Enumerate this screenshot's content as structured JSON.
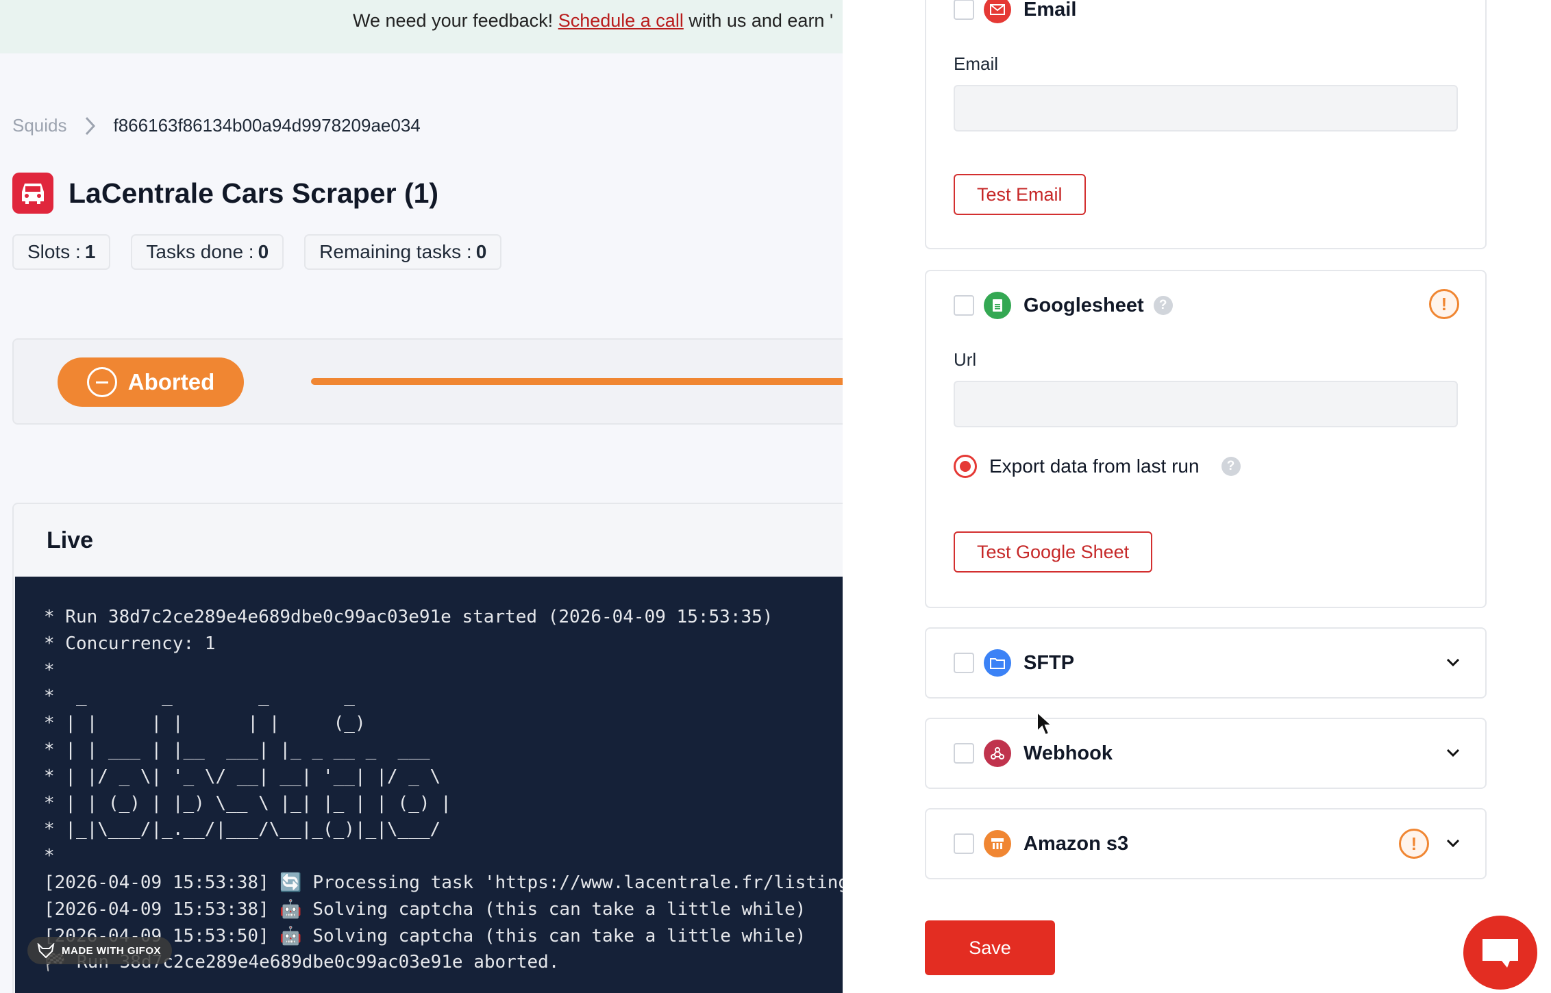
{
  "banner": {
    "text_before": "We need your feedback! ",
    "link": "Schedule a call",
    "text_after": " with us and earn '"
  },
  "breadcrumb": {
    "root": "Squids",
    "current": "f866163f86134b00a94d9978209ae034"
  },
  "header": {
    "title": "LaCentrale Cars Scraper (1)"
  },
  "stats": [
    {
      "label": "Slots : ",
      "value": "1"
    },
    {
      "label": "Tasks done : ",
      "value": "0"
    },
    {
      "label": "Remaining tasks : ",
      "value": "0"
    }
  ],
  "status": {
    "label": "Aborted",
    "progress_percent": 100,
    "color": "#f08632"
  },
  "live": {
    "title": "Live",
    "lines": [
      "* Run 38d7c2ce289e4e689dbe0c99ac03e91e started (2026-04-09 15:53:35)",
      "* Concurrency: 1",
      "*",
      "*  _       _        _       _",
      "* | |     | |      | |     (_)",
      "* | | ___ | |__  ___| |_ _ __ _  ___",
      "* | |/ _ \\| '_ \\/ __| __| '__| |/ _ \\",
      "* | | (_) | |_) \\__ \\ |_| |_ | | (_) |",
      "* |_|\\___/|_.__/|___/\\__|_(_)|_|\\___/",
      "*",
      "[2026-04-09 15:53:38] 🔄 Processing task 'https://www.lacentrale.fr/listing",
      "[2026-04-09 15:53:38] 🤖 Solving captcha (this can take a little while)",
      "[2026-04-09 15:53:50] 🤖 Solving captcha (this can take a little while)",
      "🏁 Run 38d7c2ce289e4e689dbe0c99ac03e91e aborted."
    ]
  },
  "watermark": "MADE WITH GIFOX",
  "integrations": {
    "email": {
      "name": "Email",
      "field_label": "Email",
      "value": "",
      "test_button": "Test Email",
      "icon": "envelope-icon",
      "color": "#e53935"
    },
    "googlesheet": {
      "name": "Googlesheet",
      "help": "?",
      "warning": "!",
      "field_label": "Url",
      "value": "",
      "radio_label": "Export data from last run",
      "test_button": "Test Google Sheet",
      "icon": "sheet-icon",
      "color": "#34a853"
    },
    "sftp": {
      "name": "SFTP",
      "icon": "folder-icon",
      "color": "#3b82f6"
    },
    "webhook": {
      "name": "Webhook",
      "icon": "webhook-icon",
      "color": "#c0334d"
    },
    "s3": {
      "name": "Amazon s3",
      "warning": "!",
      "icon": "bucket-icon",
      "color": "#f08632"
    }
  },
  "actions": {
    "save": "Save"
  }
}
